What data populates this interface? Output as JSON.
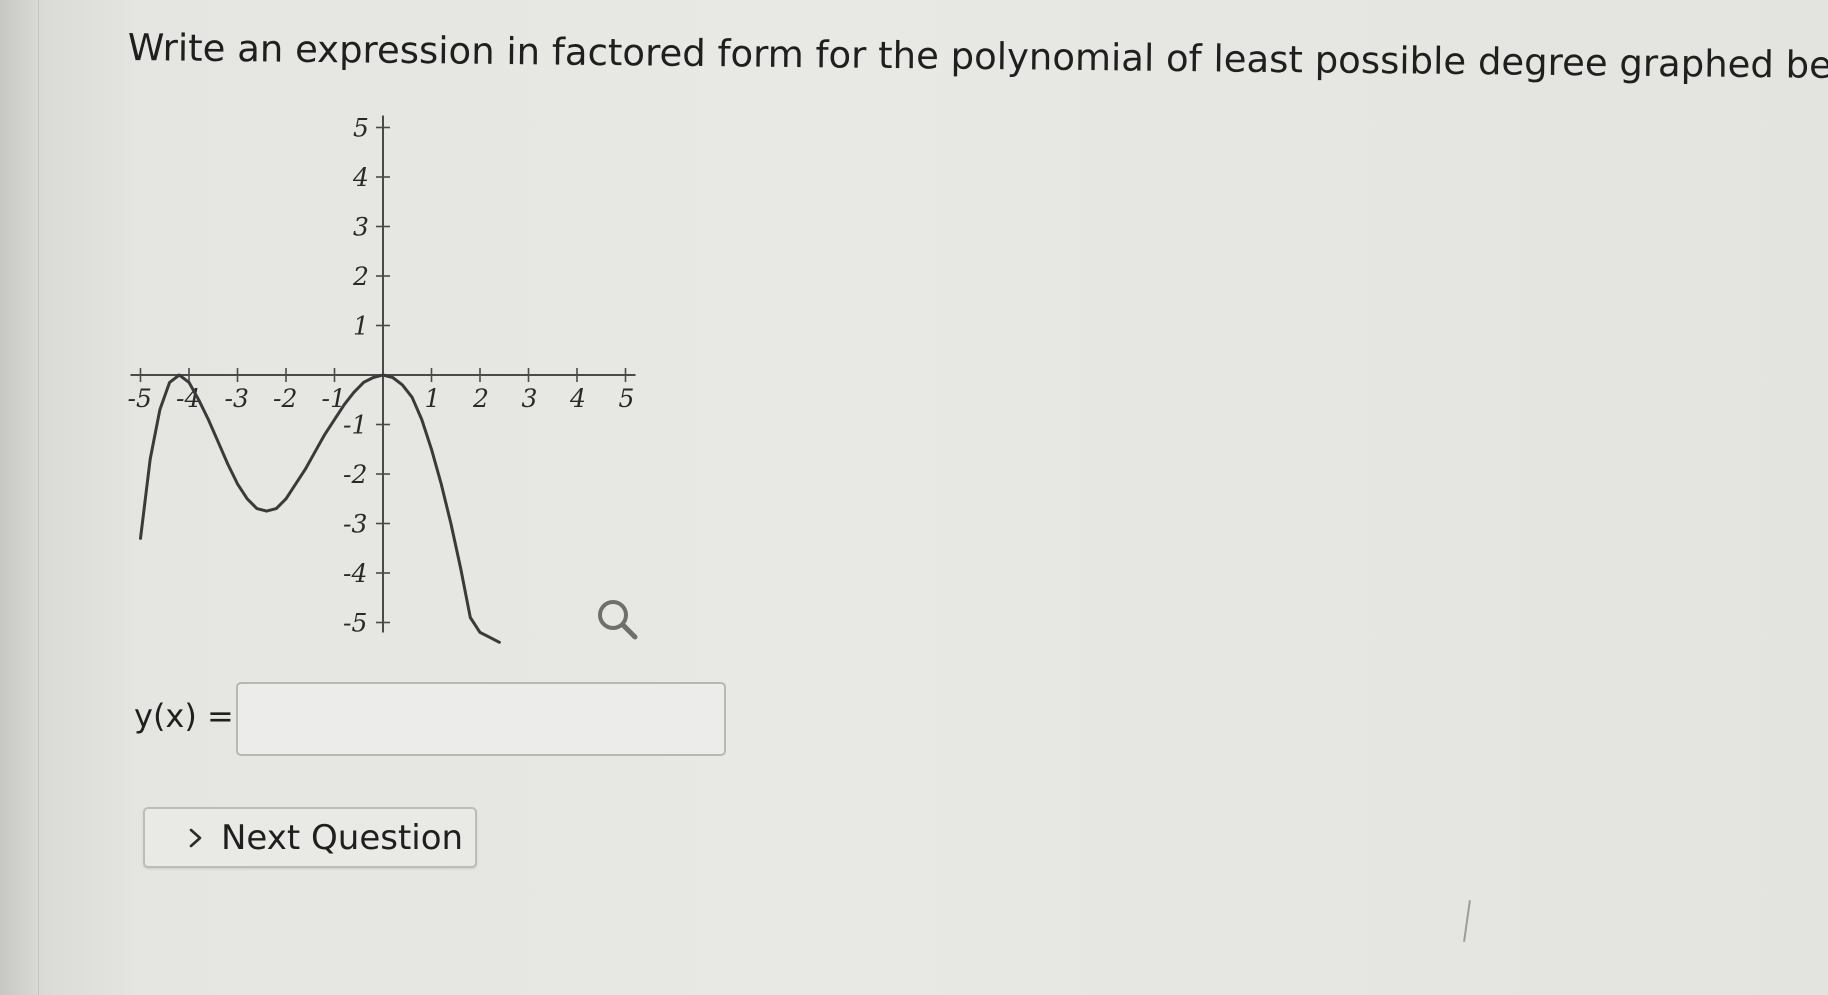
{
  "question": {
    "text": "Write an expression in factored form for the polynomial of least possible degree graphed below."
  },
  "graph": {
    "x_tick_labels": [
      "-5",
      "-4",
      "-3",
      "-2",
      "-1",
      "1",
      "2",
      "3",
      "4",
      "5"
    ],
    "y_tick_labels_positive": [
      "5",
      "4",
      "3",
      "2",
      "1"
    ],
    "y_tick_labels_negative": [
      "-1",
      "-2",
      "-3",
      "-4",
      "-5"
    ],
    "zoom_icon": "magnifier-icon",
    "chart_data": {
      "type": "line",
      "xlim": [
        -5,
        5
      ],
      "ylim": [
        -5,
        5
      ],
      "grid": false,
      "series": [
        {
          "x": [
            -5.0,
            -4.8,
            -4.6,
            -4.4,
            -4.2,
            -4.0,
            -3.8,
            -3.6,
            -3.4,
            -3.2,
            -3.0,
            -2.8,
            -2.6,
            -2.4,
            -2.2,
            -2.0,
            -1.8,
            -1.6,
            -1.4,
            -1.2,
            -1.0,
            -0.8,
            -0.6,
            -0.4,
            -0.2,
            0.0,
            0.2,
            0.4,
            0.6,
            0.8,
            1.0,
            1.2,
            1.4,
            1.6,
            1.8,
            2.0,
            2.2,
            2.4
          ],
          "y": [
            -3.3,
            -1.7,
            -0.7,
            -0.15,
            0.0,
            -0.15,
            -0.5,
            -0.9,
            -1.35,
            -1.8,
            -2.2,
            -2.5,
            -2.7,
            -2.75,
            -2.7,
            -2.5,
            -2.2,
            -1.9,
            -1.55,
            -1.2,
            -0.9,
            -0.6,
            -0.35,
            -0.15,
            -0.05,
            0.0,
            -0.05,
            -0.2,
            -0.45,
            -0.9,
            -1.5,
            -2.2,
            -3.0,
            -3.9,
            -4.9,
            -5.2,
            -5.3,
            -5.4
          ]
        }
      ]
    }
  },
  "answer": {
    "label": "y(x) =",
    "value": "",
    "placeholder": ""
  },
  "navigation": {
    "next_label": "Next Question",
    "next_icon": "chevron-right-icon"
  },
  "colors": {
    "background": "#e3e3df",
    "curve": "#3a3a3a",
    "axis": "#4a4a4a",
    "text": "#1f1f1f"
  }
}
